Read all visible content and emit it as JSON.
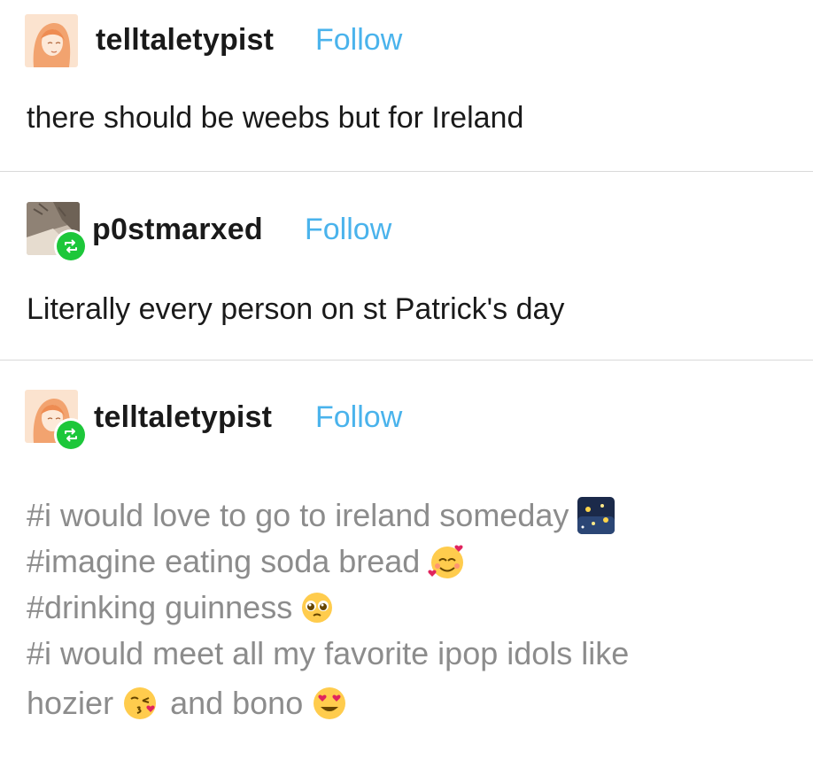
{
  "posts": [
    {
      "username": "telltaletypist",
      "follow_label": "Follow",
      "text": "there should be weebs but for Ireland"
    },
    {
      "username": "p0stmarxed",
      "follow_label": "Follow",
      "text": "Literally every person on st Patrick's day"
    },
    {
      "username": "telltaletypist",
      "follow_label": "Follow",
      "tags": [
        {
          "text": "#i would love to go to ireland someday",
          "emoji": "night-sky-emoji"
        },
        {
          "text": "#imagine eating soda bread",
          "emoji": "smiling-face-with-hearts-emoji"
        },
        {
          "text": "#drinking guinness",
          "emoji": "pleading-face-emoji"
        },
        {
          "text": "#i would meet all my favorite ipop idols like",
          "emoji": ""
        },
        {
          "text": "hozier",
          "emoji": "kissing-face-emoji",
          "after": "and bono",
          "after_emoji": "heart-eyes-emoji"
        }
      ]
    }
  ],
  "colors": {
    "follow": "#4ab3ec",
    "reblog_badge": "#1dc73a",
    "tag_text": "#8c8c8c",
    "divider": "#d9d9d9"
  }
}
